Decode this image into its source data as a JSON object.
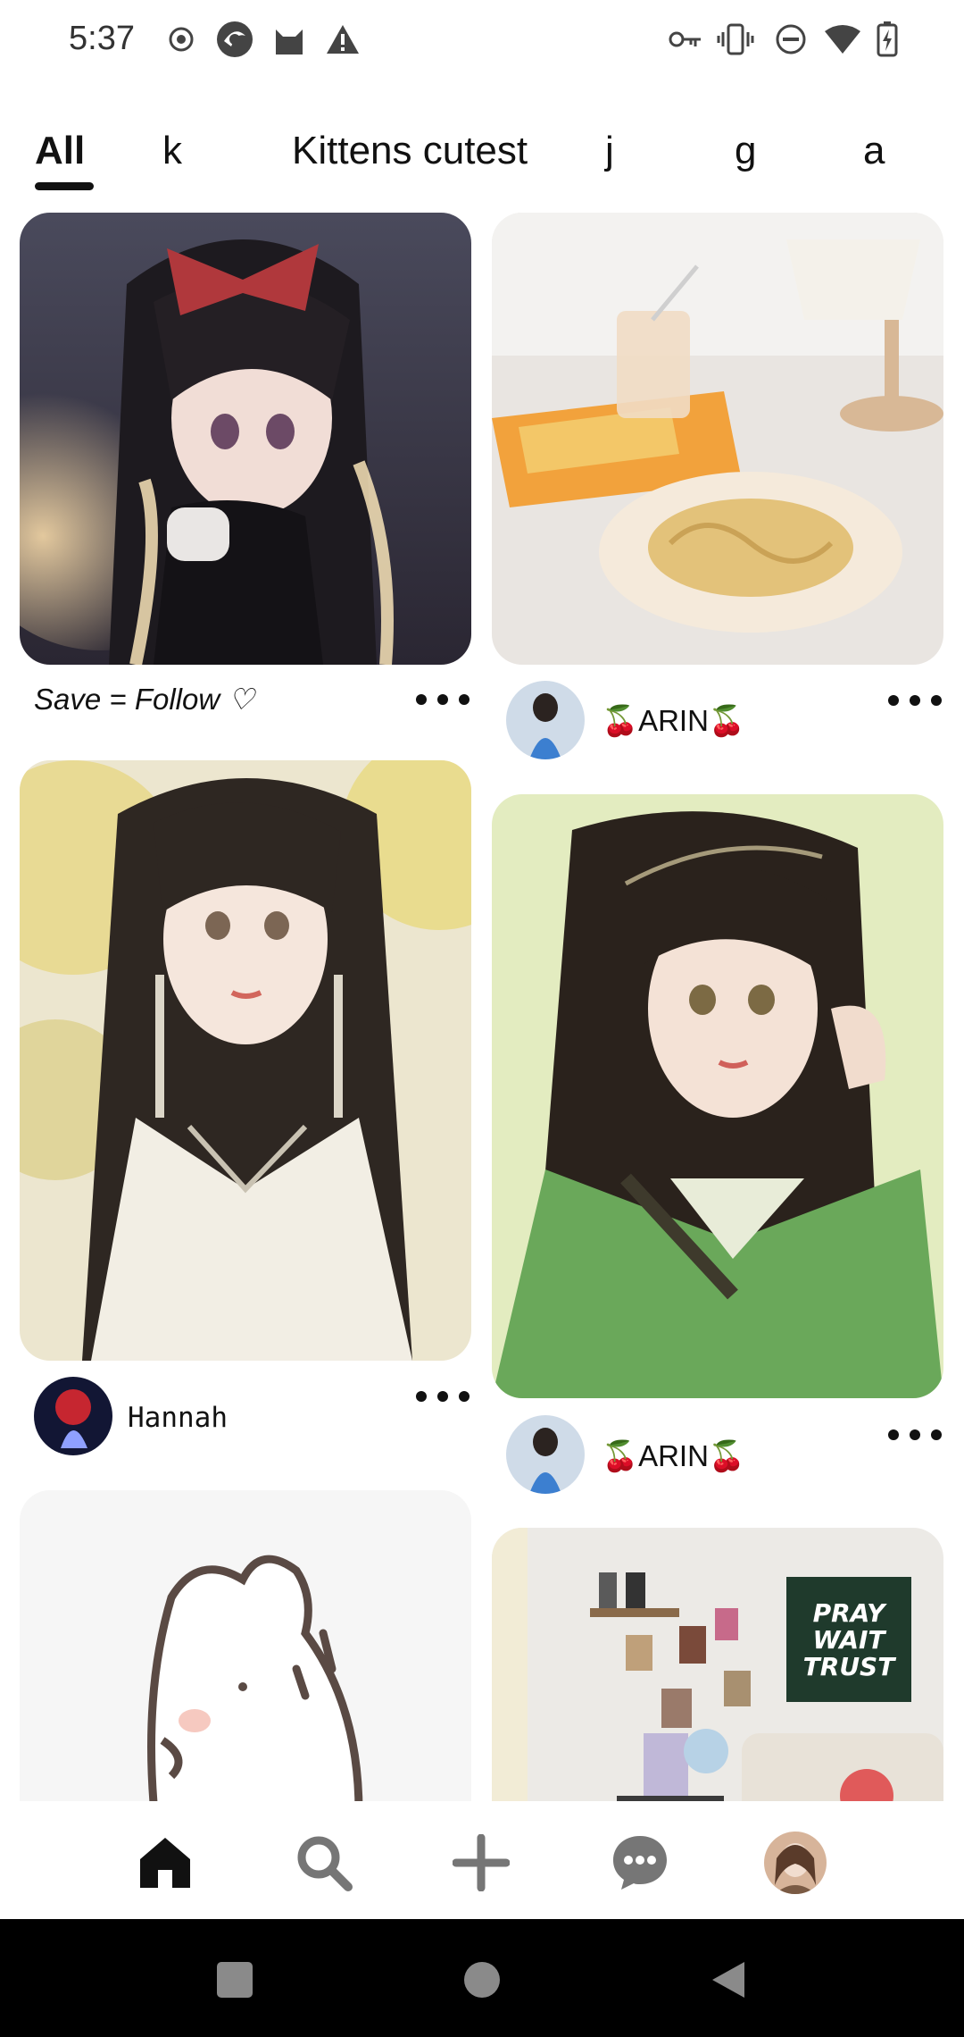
{
  "status_bar": {
    "time": "5:37",
    "left_icons": [
      "record-icon",
      "browser-icon",
      "cat-icon",
      "warning-icon"
    ],
    "right_icons": [
      "key-icon",
      "vibrate-icon",
      "do-not-disturb-icon",
      "wifi-icon",
      "battery-charging-icon"
    ]
  },
  "tabs": [
    {
      "label": "All",
      "active": true
    },
    {
      "label": "k",
      "active": false
    },
    {
      "label": "Kittens cutest",
      "active": false
    },
    {
      "label": "j",
      "active": false
    },
    {
      "label": "g",
      "active": false
    },
    {
      "label": "a",
      "active": false
    }
  ],
  "pins": {
    "left": [
      {
        "image": "anime girl with red bow at night",
        "caption": "Save = Follow ♡"
      },
      {
        "image": "anime girl with long dark hair and earrings",
        "username": "Hannah"
      },
      {
        "image": "cute white cartoon bear sketch"
      }
    ],
    "right": [
      {
        "image": "pasta plate and drink with lamp",
        "username": "🍒ARIN🍒"
      },
      {
        "image": "anime girl in green robe",
        "username": "🍒ARIN🍒"
      },
      {
        "image": "room wall decor with poster",
        "poster_text": [
          "PRAY",
          "WAIT",
          "TRUST"
        ]
      }
    ]
  },
  "bottom_nav": [
    {
      "name": "home-icon",
      "active": true
    },
    {
      "name": "search-icon",
      "active": false
    },
    {
      "name": "create-plus-icon",
      "active": false
    },
    {
      "name": "messages-icon",
      "active": false
    },
    {
      "name": "profile-avatar",
      "active": false
    }
  ],
  "system_nav": [
    "recents-square-icon",
    "home-circle-icon",
    "back-triangle-icon"
  ],
  "colors": {
    "background": "#ffffff",
    "text": "#111111",
    "icon_gray": "#767676",
    "system_nav_bg": "#000000"
  }
}
